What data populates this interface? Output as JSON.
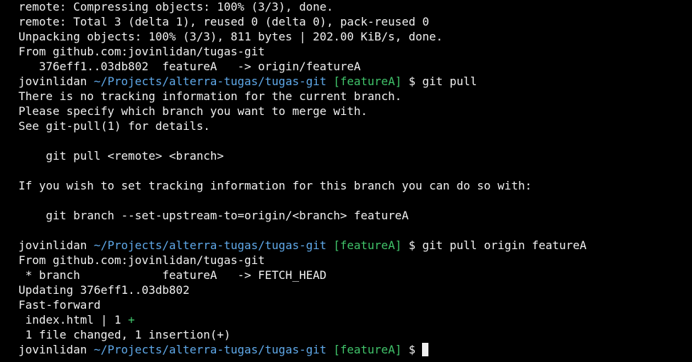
{
  "terminal": {
    "prompt": {
      "user": "jovinlidan",
      "path": "~/Projects/alterra-tugas/tugas-git",
      "branch": "[featureA]",
      "symbol": "$"
    },
    "lines": {
      "l1": "remote: Compressing objects: 100% (3/3), done.",
      "l2": "remote: Total 3 (delta 1), reused 0 (delta 0), pack-reused 0",
      "l3": "Unpacking objects: 100% (3/3), 811 bytes | 202.00 KiB/s, done.",
      "l4": "From github.com:jovinlidan/tugas-git",
      "l5": "   376eff1..03db802  featureA   -> origin/featureA",
      "cmd1": "git pull",
      "l7": "There is no tracking information for the current branch.",
      "l8": "Please specify which branch you want to merge with.",
      "l9": "See git-pull(1) for details.",
      "l11": "    git pull <remote> <branch>",
      "l13": "If you wish to set tracking information for this branch you can do so with:",
      "l15": "    git branch --set-upstream-to=origin/<branch> featureA",
      "cmd2": "git pull origin featureA",
      "l18": "From github.com:jovinlidan/tugas-git",
      "l19": " * branch            featureA   -> FETCH_HEAD",
      "l20": "Updating 376eff1..03db802",
      "l21": "Fast-forward",
      "l22": " index.html | 1 ",
      "l22_plus": "+",
      "l23": " 1 file changed, 1 insertion(+)"
    },
    "colors": {
      "background": "#000000",
      "text": "#f0f0f0",
      "path": "#5fa8e8",
      "branch": "#40c36a"
    }
  }
}
